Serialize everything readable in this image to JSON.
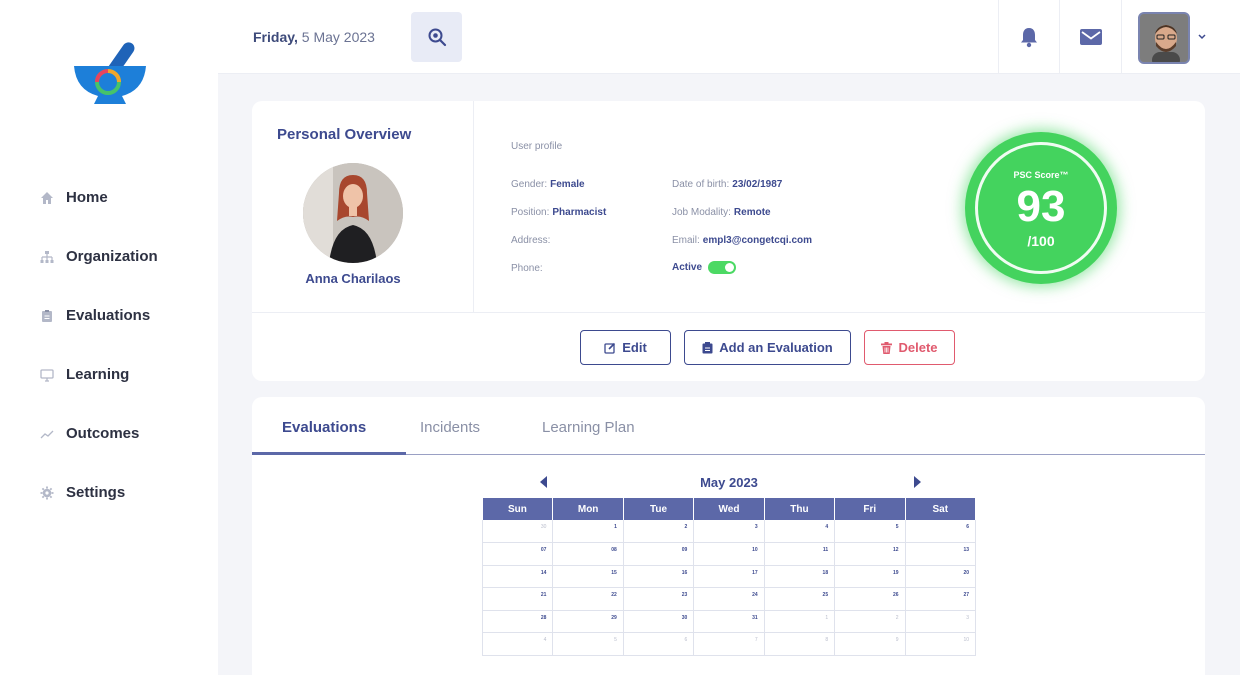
{
  "topbar": {
    "date_day": "Friday,",
    "date_rest": "5 May 2023"
  },
  "sidebar": {
    "items": [
      {
        "label": "Home",
        "icon": "home-icon"
      },
      {
        "label": "Organization",
        "icon": "org-chart-icon"
      },
      {
        "label": "Evaluations",
        "icon": "clipboard-icon"
      },
      {
        "label": "Learning",
        "icon": "monitor-icon"
      },
      {
        "label": "Outcomes",
        "icon": "trend-line-icon"
      },
      {
        "label": "Settings",
        "icon": "gear-icon"
      }
    ]
  },
  "overview": {
    "title": "Personal Overview",
    "name": "Anna Charilaos",
    "section_label": "User profile",
    "gender_label": "Gender:",
    "gender": "Female",
    "position_label": "Position:",
    "position": "Pharmacist",
    "address_label": "Address:",
    "phone_label": "Phone:",
    "dob_label": "Date of birth:",
    "dob": "23/02/1987",
    "modality_label": "Job Modality:",
    "modality": "Remote",
    "email_label": "Email:",
    "email": "empl3@congetcqi.com",
    "status": "Active",
    "status_on": true
  },
  "score": {
    "label": "PSC Score™",
    "value": "93",
    "max": "/100",
    "color": "#44d35e"
  },
  "actions": {
    "edit": "Edit",
    "add": "Add an Evaluation",
    "delete": "Delete"
  },
  "tabs": [
    {
      "label": "Evaluations",
      "active": true
    },
    {
      "label": "Incidents",
      "active": false
    },
    {
      "label": "Learning Plan",
      "active": false
    }
  ],
  "calendar": {
    "title": "May 2023",
    "days": [
      "Sun",
      "Mon",
      "Tue",
      "Wed",
      "Thu",
      "Fri",
      "Sat"
    ],
    "weeks": [
      [
        "30",
        "1",
        "2",
        "3",
        "4",
        "5",
        "6"
      ],
      [
        "07",
        "08",
        "09",
        "10",
        "11",
        "12",
        "13"
      ],
      [
        "14",
        "15",
        "16",
        "17",
        "18",
        "19",
        "20"
      ],
      [
        "21",
        "22",
        "23",
        "24",
        "25",
        "26",
        "27"
      ],
      [
        "28",
        "29",
        "30",
        "31",
        "1",
        "2",
        "3"
      ],
      [
        "4",
        "5",
        "6",
        "7",
        "8",
        "9",
        "10"
      ]
    ],
    "muted": [
      [
        true,
        false,
        false,
        false,
        false,
        false,
        false
      ],
      [
        false,
        false,
        false,
        false,
        false,
        false,
        false
      ],
      [
        false,
        false,
        false,
        false,
        false,
        false,
        false
      ],
      [
        false,
        false,
        false,
        false,
        false,
        false,
        false
      ],
      [
        false,
        false,
        false,
        false,
        true,
        true,
        true
      ],
      [
        true,
        true,
        true,
        true,
        true,
        true,
        true
      ]
    ]
  },
  "colors": {
    "accent": "#3d4a8f",
    "header": "#5c68a8",
    "danger": "#e05a6e",
    "active": "#4cd964"
  }
}
